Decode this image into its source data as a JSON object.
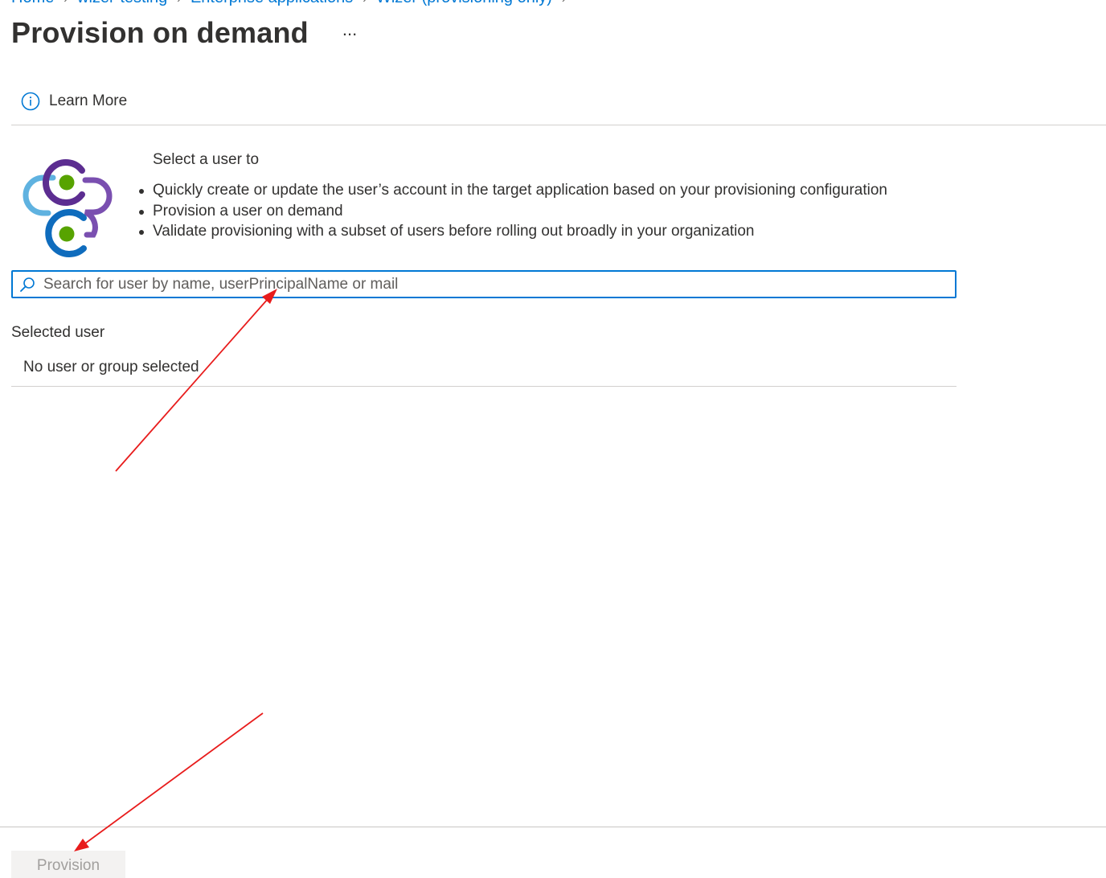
{
  "breadcrumb": {
    "items": [
      "Home",
      "wizer-testing",
      "Enterprise applications",
      "Wizer (provisioning only)"
    ]
  },
  "header": {
    "title": "Provision on demand",
    "more_label": "..."
  },
  "toolbar": {
    "learn_more_label": "Learn More",
    "icon": "info-icon"
  },
  "intro": {
    "lead": "Select a user to",
    "bullets": [
      "Quickly create or update the user’s account in the target application based on your provisioning configuration",
      "Provision a user on demand",
      "Validate provisioning with a subset of users before rolling out broadly in your organization"
    ]
  },
  "search": {
    "placeholder": "Search for user by name, userPrincipalName or mail",
    "value": ""
  },
  "selected": {
    "label": "Selected user",
    "value": "No user or group selected"
  },
  "footer": {
    "provision_label": "Provision",
    "provision_disabled": true
  },
  "colors": {
    "accent": "#0078d4",
    "annotation_arrow": "#e81c1c",
    "icon_purple": "#5c2d91",
    "icon_green": "#57a300",
    "icon_lightblue": "#5fb2e0"
  }
}
